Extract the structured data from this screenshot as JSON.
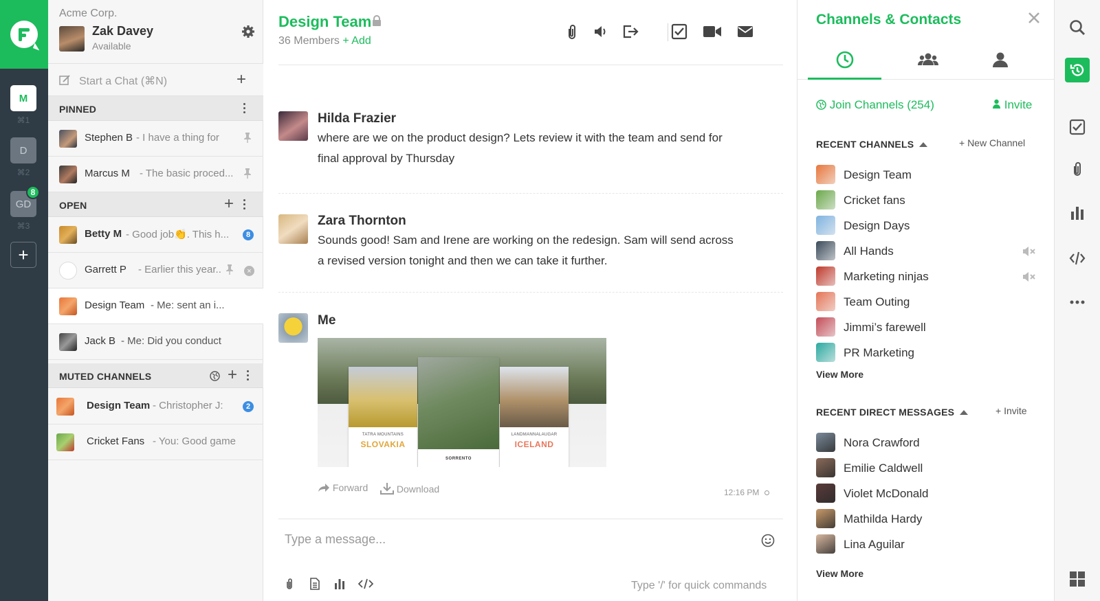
{
  "rail": {
    "workspaces": [
      {
        "letter": "M",
        "key": "⌘1"
      },
      {
        "letter": "D",
        "key": "⌘2"
      },
      {
        "letter": "GD",
        "key": "⌘3",
        "badge": "8"
      }
    ],
    "add_label": "+"
  },
  "sidebar": {
    "org": "Acme Corp.",
    "user_name": "Zak Davey",
    "user_status": "Available",
    "start_chat": "Start a Chat (⌘N)",
    "sections": {
      "pinned": "PINNED",
      "open": "OPEN",
      "muted": "MUTED CHANNELS"
    },
    "pinned": [
      {
        "name": "Stephen B",
        "preview": "- I have a thing for"
      },
      {
        "name": "Marcus M",
        "preview": "- The basic proced..."
      }
    ],
    "open": [
      {
        "name": "Betty M",
        "preview": "- Good job👏. This h...",
        "count": "8"
      },
      {
        "name": "Garrett P",
        "preview": "- Earlier this year..."
      },
      {
        "name": "Design Team",
        "preview": "- Me: sent an i..."
      },
      {
        "name": "Jack B",
        "preview": "- Me: Did you conduct"
      }
    ],
    "muted": [
      {
        "name": "Design Team",
        "preview": "- Christopher J:",
        "count": "2"
      },
      {
        "name": "Cricket Fans",
        "preview": "- You: Good game"
      }
    ]
  },
  "channel": {
    "title": "Design Team",
    "members": "36 Members",
    "add": "+ Add",
    "toolbar_icons": [
      "paperclip-icon",
      "speaker-icon",
      "leave-icon",
      "checkbox-icon",
      "video-icon",
      "mail-icon"
    ]
  },
  "messages": [
    {
      "author": "Hilda Frazier",
      "text": "where are we on the product design? Lets review it with the team and send for final approval by Thursday"
    },
    {
      "author": "Zara Thornton",
      "text": "Sounds good! Sam and Irene are working on the redesign. Sam will send across a revised version tonight and then we can take it further."
    },
    {
      "author": "Me",
      "attachment": {
        "cards": [
          {
            "subtitle": "TATRA MOUNTAINS",
            "title": "SLOVAKIA",
            "title_color": "#e0a63a"
          },
          {
            "subtitle": "",
            "title": "SORRENTO",
            "title_color": "#333333"
          },
          {
            "subtitle": "LANDMANNALAUGAR",
            "title": "ICELAND",
            "title_color": "#e8765a"
          }
        ]
      },
      "actions": {
        "forward": "Forward",
        "download": "Download"
      },
      "time": "12:16 PM"
    }
  ],
  "composer": {
    "placeholder": "Type a message...",
    "hint": "Type '/' for quick commands"
  },
  "panel": {
    "title": "Channels & Contacts",
    "join": "Join Channels (254)",
    "invite": "Invite",
    "recent_channels_label": "RECENT CHANNELS",
    "new_channel": "+ New Channel",
    "channels": [
      {
        "name": "Design Team",
        "muted": false,
        "color": "#e8763a"
      },
      {
        "name": "Cricket fans",
        "muted": false,
        "color": "#6ba84a"
      },
      {
        "name": "Design Days",
        "muted": false,
        "color": "#7fb3e0"
      },
      {
        "name": "All Hands",
        "muted": true,
        "color": "#3a4a5a"
      },
      {
        "name": "Marketing ninjas",
        "muted": true,
        "color": "#c0392b"
      },
      {
        "name": "Team Outing",
        "muted": false,
        "color": "#e57455"
      },
      {
        "name": "Jimmi’s farewell",
        "muted": false,
        "color": "#c44d58"
      },
      {
        "name": "PR Marketing",
        "muted": false,
        "color": "#2aa9a0"
      }
    ],
    "view_more": "View More",
    "recent_dm_label": "RECENT DIRECT MESSAGES",
    "dm_invite": "+ Invite",
    "dms": [
      {
        "name": "Nora Crawford"
      },
      {
        "name": "Emilie Caldwell"
      },
      {
        "name": "Violet McDonald"
      },
      {
        "name": "Mathilda Hardy"
      },
      {
        "name": "Lina Aguilar"
      }
    ]
  },
  "colors": {
    "accent": "#1cbc5c",
    "rail": "#2f3b45",
    "badge_blue": "#3c8ee3"
  }
}
